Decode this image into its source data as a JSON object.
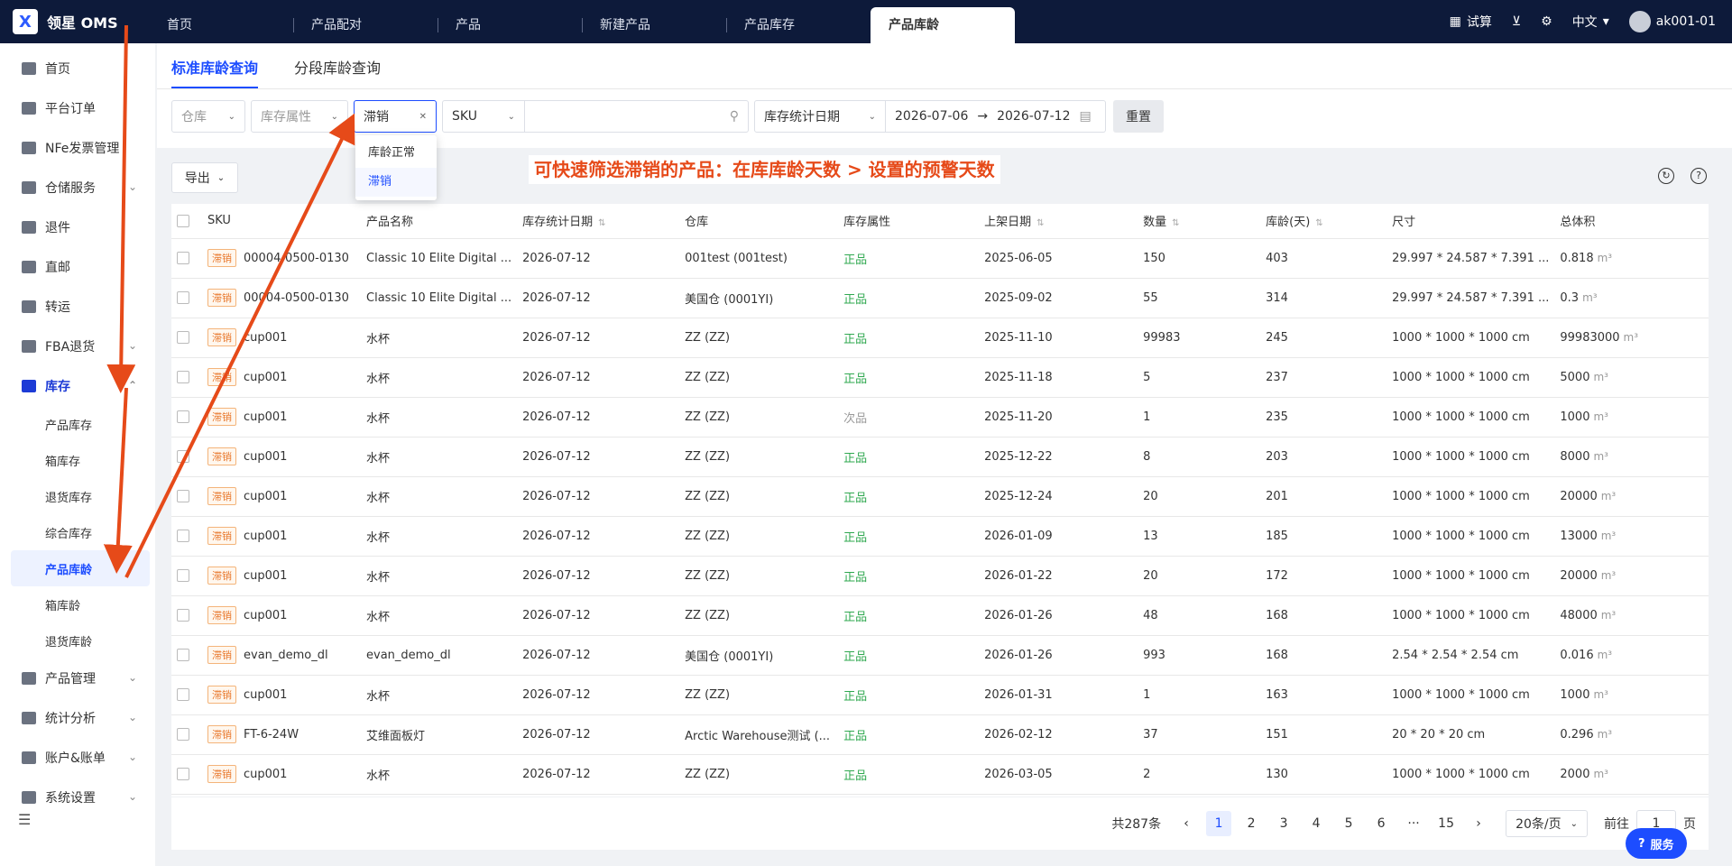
{
  "brand": {
    "name": "领星 OMS",
    "logo_letter": "X"
  },
  "top_tabs": [
    "首页",
    "产品配对",
    "产品",
    "新建产品",
    "产品库存",
    "产品库龄"
  ],
  "top_tools": {
    "calc": "试算",
    "lang": "中文",
    "user": "ak001-01"
  },
  "sidebar": {
    "items": [
      {
        "label": "首页",
        "expand": ""
      },
      {
        "label": "平台订单",
        "expand": ""
      },
      {
        "label": "NFe发票管理",
        "expand": ""
      },
      {
        "label": "仓储服务",
        "expand": "⌄"
      },
      {
        "label": "退件",
        "expand": ""
      },
      {
        "label": "直邮",
        "expand": ""
      },
      {
        "label": "转运",
        "expand": ""
      },
      {
        "label": "FBA退货",
        "expand": "⌄"
      },
      {
        "label": "库存",
        "expand": "⌃"
      }
    ],
    "sub_items": [
      "产品库存",
      "箱库存",
      "退货库存",
      "综合库存",
      "产品库龄",
      "箱库龄",
      "退货库龄"
    ],
    "items_after": [
      {
        "label": "产品管理",
        "expand": "⌄"
      },
      {
        "label": "统计分析",
        "expand": "⌄"
      },
      {
        "label": "账户&账单",
        "expand": "⌄"
      },
      {
        "label": "系统设置",
        "expand": "⌄"
      }
    ]
  },
  "subtabs": [
    "标准库龄查询",
    "分段库龄查询"
  ],
  "filters": {
    "warehouse": "仓库",
    "stock_attr": "库存属性",
    "aging": "滞销",
    "sku_type": "SKU",
    "date_type": "库存统计日期",
    "date_from": "2026-07-06",
    "date_to": "2026-07-12",
    "reset": "重置"
  },
  "dropdown": [
    "库龄正常",
    "滞销"
  ],
  "export": "导出",
  "annotation": "可快速筛选滞销的产品：在库库龄天数 > 设置的预警天数",
  "table": {
    "headers": [
      "SKU",
      "产品名称",
      "库存统计日期",
      "仓库",
      "库存属性",
      "上架日期",
      "数量",
      "库龄(天)",
      "尺寸",
      "总体积"
    ],
    "tag": "滞销",
    "rows": [
      [
        "00004-0500-0130",
        "Classic 10 Elite Digital ...",
        "2026-07-12",
        "001test (001test)",
        "正品",
        "2025-06-05",
        "150",
        "403",
        "29.997 * 24.587 * 7.391 ...",
        "0.818"
      ],
      [
        "00004-0500-0130",
        "Classic 10 Elite Digital ...",
        "2026-07-12",
        "美国仓 (0001YI)",
        "正品",
        "2025-09-02",
        "55",
        "314",
        "29.997 * 24.587 * 7.391 ...",
        "0.3"
      ],
      [
        "cup001",
        "水杯",
        "2026-07-12",
        "ZZ (ZZ)",
        "正品",
        "2025-11-10",
        "99983",
        "245",
        "1000 * 1000 * 1000 cm",
        "99983000"
      ],
      [
        "cup001",
        "水杯",
        "2026-07-12",
        "ZZ (ZZ)",
        "正品",
        "2025-11-18",
        "5",
        "237",
        "1000 * 1000 * 1000 cm",
        "5000"
      ],
      [
        "cup001",
        "水杯",
        "2026-07-12",
        "ZZ (ZZ)",
        "次品",
        "2025-11-20",
        "1",
        "235",
        "1000 * 1000 * 1000 cm",
        "1000"
      ],
      [
        "cup001",
        "水杯",
        "2026-07-12",
        "ZZ (ZZ)",
        "正品",
        "2025-12-22",
        "8",
        "203",
        "1000 * 1000 * 1000 cm",
        "8000"
      ],
      [
        "cup001",
        "水杯",
        "2026-07-12",
        "ZZ (ZZ)",
        "正品",
        "2025-12-24",
        "20",
        "201",
        "1000 * 1000 * 1000 cm",
        "20000"
      ],
      [
        "cup001",
        "水杯",
        "2026-07-12",
        "ZZ (ZZ)",
        "正品",
        "2026-01-09",
        "13",
        "185",
        "1000 * 1000 * 1000 cm",
        "13000"
      ],
      [
        "cup001",
        "水杯",
        "2026-07-12",
        "ZZ (ZZ)",
        "正品",
        "2026-01-22",
        "20",
        "172",
        "1000 * 1000 * 1000 cm",
        "20000"
      ],
      [
        "cup001",
        "水杯",
        "2026-07-12",
        "ZZ (ZZ)",
        "正品",
        "2026-01-26",
        "48",
        "168",
        "1000 * 1000 * 1000 cm",
        "48000"
      ],
      [
        "evan_demo_dl",
        "evan_demo_dl",
        "2026-07-12",
        "美国仓 (0001YI)",
        "正品",
        "2026-01-26",
        "993",
        "168",
        "2.54 * 2.54 * 2.54 cm",
        "0.016"
      ],
      [
        "cup001",
        "水杯",
        "2026-07-12",
        "ZZ (ZZ)",
        "正品",
        "2026-01-31",
        "1",
        "163",
        "1000 * 1000 * 1000 cm",
        "1000"
      ],
      [
        "FT-6-24W",
        "艾维面板灯",
        "2026-07-12",
        "Arctic Warehouse测试 (...",
        "正品",
        "2026-02-12",
        "37",
        "151",
        "20 * 20 * 20 cm",
        "0.296"
      ],
      [
        "cup001",
        "水杯",
        "2026-07-12",
        "ZZ (ZZ)",
        "正品",
        "2026-03-05",
        "2",
        "130",
        "1000 * 1000 * 1000 cm",
        "2000"
      ]
    ],
    "volume_unit": "m³"
  },
  "pager": {
    "total": "共287条",
    "pages": [
      "1",
      "2",
      "3",
      "4",
      "5",
      "6",
      "···",
      "15"
    ],
    "size": "20条/页",
    "goto": "前往",
    "goto_value": "1",
    "page_word": "页"
  },
  "service": "服务",
  "colors": {
    "accent": "#1d4dff",
    "topbar": "#0d1a3a",
    "annot": "#e64a19",
    "tag": "#e8772b",
    "ok": "#2fa84f"
  }
}
